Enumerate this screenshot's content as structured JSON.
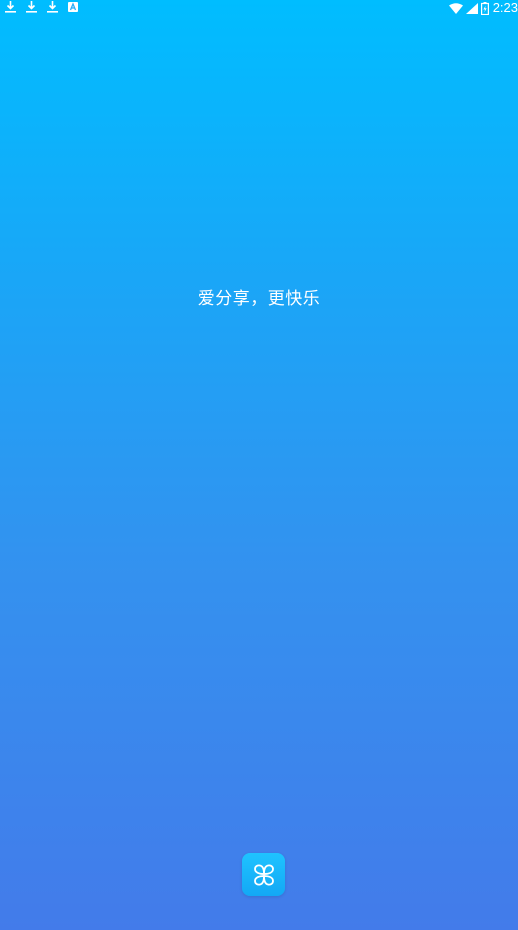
{
  "status_bar": {
    "left_icons": [
      "download-icon",
      "download-icon",
      "download-icon",
      "translate-a-icon"
    ],
    "right_icons": [
      "wifi-icon",
      "cell-signal-icon",
      "battery-charging-icon"
    ],
    "time": "2:23"
  },
  "splash": {
    "slogan": "爱分享，更快乐",
    "logo_icon": "app-logo-icon"
  },
  "colors": {
    "gradient_top": "#00BDFF",
    "gradient_bottom": "#437BEA",
    "text": "#FFFFFF",
    "logo_bg": "#13A8F5"
  }
}
